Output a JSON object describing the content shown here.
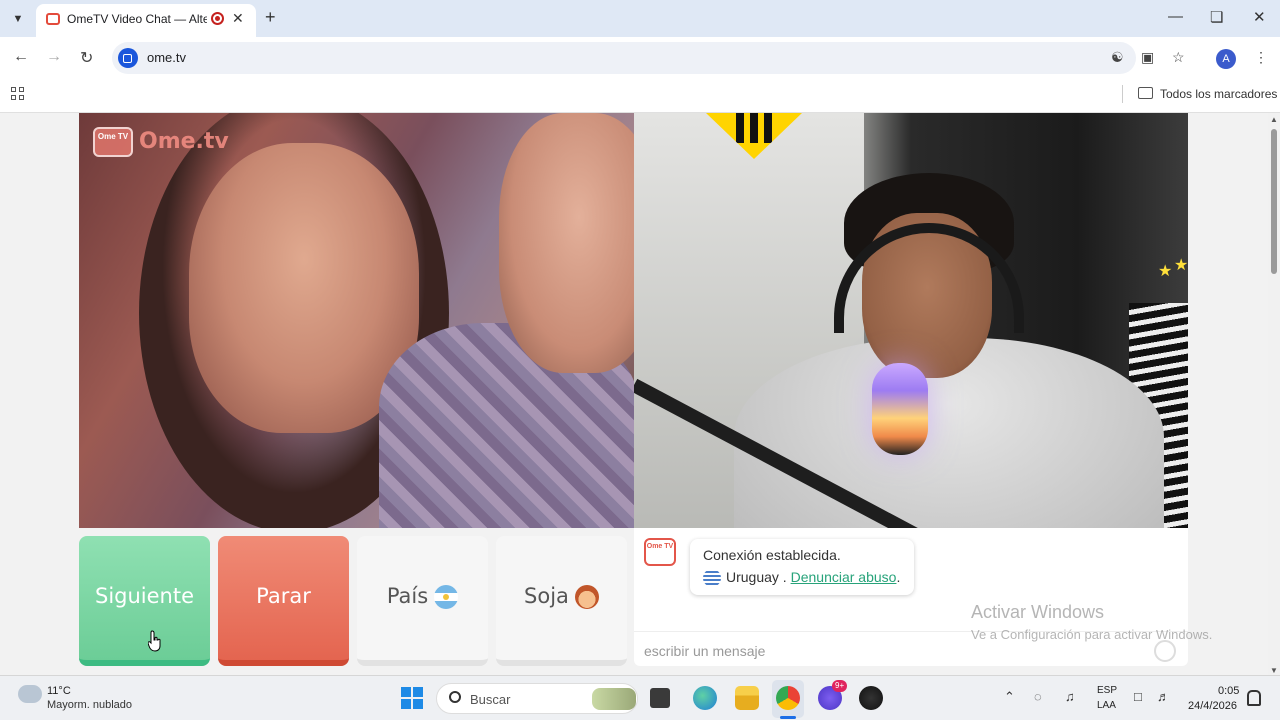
{
  "browser": {
    "tab_title": "OmeTV Video Chat — Alter",
    "url": "ome.tv",
    "bookmarks_label": "Todos los marcadores",
    "profile_initial": "A",
    "icons": [
      "tab-search-icon",
      "back-icon",
      "forward-icon",
      "reload-icon",
      "translate-icon",
      "install-icon",
      "star-icon",
      "more-icon",
      "apps-icon",
      "folder-icon"
    ]
  },
  "site": {
    "watermark_tv": "Ome TV",
    "watermark_text": "Ome.tv",
    "buttons": {
      "next": "Siguiente",
      "stop": "Parar",
      "country": "País",
      "me": "Soja"
    },
    "chat": {
      "logo": "Ome TV",
      "status": "Conexión establecida.",
      "country": "Uruguay .",
      "report": "Denunciar abuso",
      "report_suffix": ".",
      "input_placeholder": "escribir un mensaje"
    },
    "colors": {
      "next": "#6ccd97",
      "stop": "#e46550",
      "link": "#27a37a"
    }
  },
  "windows_watermark": {
    "title": "Activar Windows",
    "subtitle": "Ve a Configuración para activar Windows."
  },
  "taskbar": {
    "weather_temp": "11°C",
    "weather_desc": "Mayorm. nublado",
    "search_label": "Buscar",
    "badge": "9+",
    "lang1": "ESP",
    "lang2": "LAA",
    "time": "0:05",
    "date": "24/4/2026"
  }
}
